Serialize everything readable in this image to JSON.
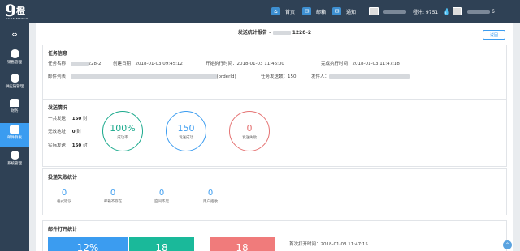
{
  "header": {
    "logo_main": "9",
    "logo_sub": "橙",
    "logo_tag": "ECOMMERCE",
    "nav": [
      {
        "icon": "home-icon",
        "label": "首页"
      },
      {
        "icon": "mail-icon",
        "label": "邮箱"
      },
      {
        "icon": "notice-icon",
        "label": "通知"
      }
    ],
    "balance_label": "橙汁: 9751",
    "user_suffix": "6"
  },
  "sidebar": {
    "items": [
      {
        "icon": "swap-icon",
        "label": ""
      },
      {
        "icon": "sales-icon",
        "label": "销售管理"
      },
      {
        "icon": "supply-icon",
        "label": "供应链管理"
      },
      {
        "icon": "finance-icon",
        "label": "财务"
      },
      {
        "icon": "mail-marketing-icon",
        "label": "邮件群发"
      },
      {
        "icon": "settings-icon",
        "label": "系统管理"
      }
    ]
  },
  "page": {
    "title": "发送统计报告 -",
    "title_suffix": "1228-2",
    "back_label": "返回"
  },
  "task": {
    "section_title": "任务信息",
    "name_label": "任务名称：",
    "name_suffix": "228-2",
    "created_label": "创建日期：",
    "created_value": "2018-01-03 09:45:12",
    "start_label": "开始执行时间：",
    "start_value": "2018-01-03 11:46:00",
    "finish_label": "完成执行时间：",
    "finish_value": "2018-01-03 11:47:18",
    "maillist_label": "邮件列表：",
    "maillist_suffix": "(orderId)",
    "sendcount_label": "任务发送数：",
    "sendcount_value": "150",
    "sender_label": "发件人："
  },
  "send": {
    "section_title": "发送情况",
    "total_label": "一共发送",
    "total_value": "150",
    "total_unit": "封",
    "invalid_label": "无效地址",
    "invalid_value": "0",
    "invalid_unit": "封",
    "actual_label": "实际发送",
    "actual_value": "150",
    "actual_unit": "封",
    "rate_value": "100%",
    "rate_label": "成功率",
    "success_value": "150",
    "success_label": "发送成功",
    "failed_value": "0",
    "failed_label": "发送失败",
    "colors": {
      "rate": "#1aa98c",
      "success": "#3b9cf0",
      "failed": "#e57373"
    }
  },
  "failure": {
    "section_title": "投递失败统计",
    "items": [
      {
        "value": "0",
        "label": "格式错误"
      },
      {
        "value": "0",
        "label": "邮箱不存在"
      },
      {
        "value": "0",
        "label": "空间不足"
      },
      {
        "value": "0",
        "label": "用户拒收"
      }
    ]
  },
  "open": {
    "section_title": "邮件打开统计",
    "boxes": [
      "12%",
      "18",
      "18"
    ],
    "first_open_label": "首次打开时间：",
    "first_open_value": "2018-01-03 11:47:15"
  }
}
